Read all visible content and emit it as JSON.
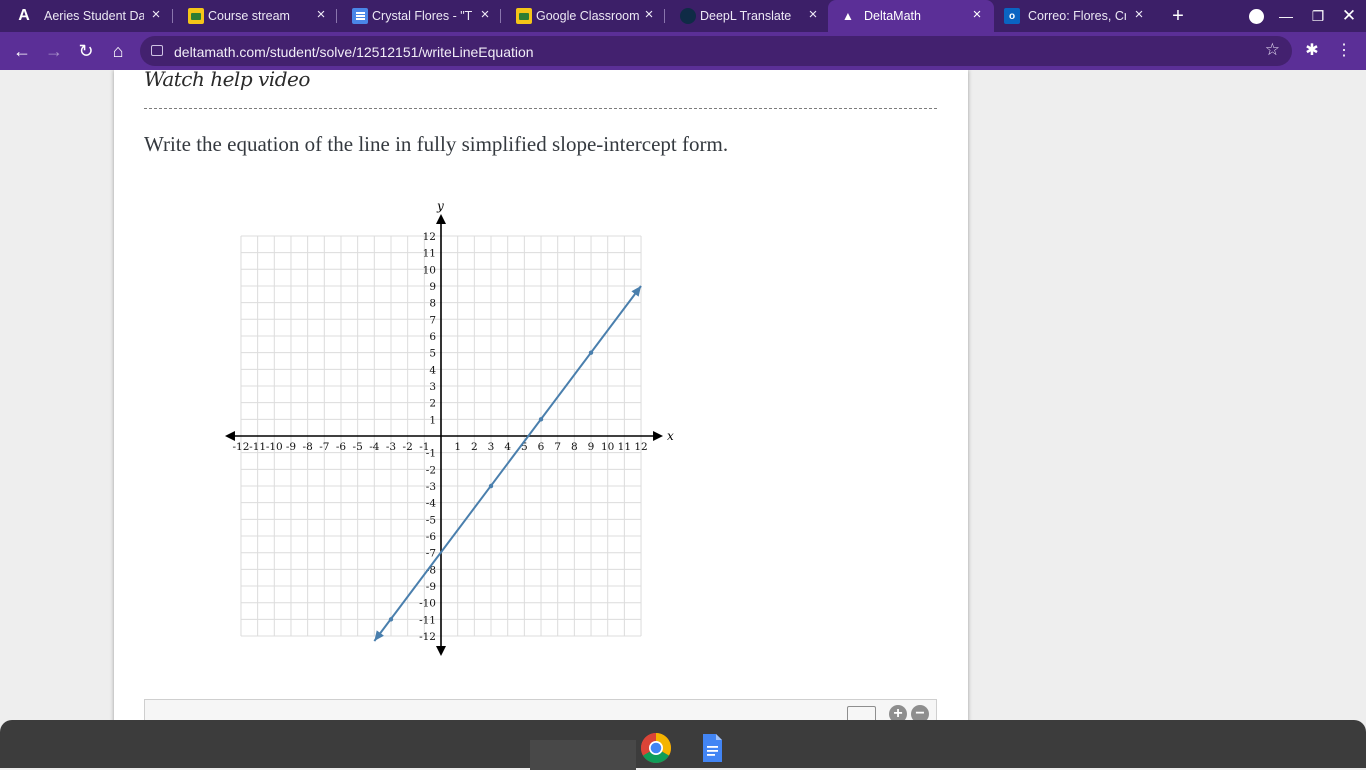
{
  "tabs": [
    {
      "title": "Aeries Student Da",
      "icon": "aeries-icon",
      "active": false
    },
    {
      "title": "Course stream",
      "icon": "classroom-icon",
      "active": false
    },
    {
      "title": "Crystal Flores - \"Th",
      "icon": "docs-icon",
      "active": false
    },
    {
      "title": "Google Classroom",
      "icon": "classroom-icon",
      "active": false
    },
    {
      "title": "DeepL Translate",
      "icon": "deepl-icon",
      "active": false
    },
    {
      "title": "DeltaMath",
      "icon": "deltamath-icon",
      "active": true
    },
    {
      "title": "Correo: Flores, Cry",
      "icon": "outlook-icon",
      "active": false
    }
  ],
  "address_bar": {
    "url": "deltamath.com/student/solve/12512151/writeLineEquation"
  },
  "page": {
    "help_link": "Watch help video",
    "instruction": "Write the equation of the line in fully simplified slope-intercept form."
  },
  "graph": {
    "x_axis_label": "x",
    "y_axis_label": "y",
    "x_range": [
      -12,
      12
    ],
    "y_range": [
      -12,
      12
    ],
    "grid": true,
    "x_ticks": [
      -12,
      -11,
      -10,
      -9,
      -8,
      -7,
      -6,
      -5,
      -4,
      -3,
      -2,
      -1,
      1,
      2,
      3,
      4,
      5,
      6,
      7,
      8,
      9,
      10,
      11,
      12
    ],
    "y_ticks": [
      12,
      11,
      10,
      9,
      8,
      7,
      6,
      5,
      4,
      3,
      2,
      1,
      -1,
      -2,
      -3,
      -4,
      -5,
      -6,
      -7,
      -8,
      -9,
      -10,
      -11,
      -12
    ],
    "line": {
      "points": [
        [
          -3,
          -11
        ],
        [
          3,
          -3
        ],
        [
          6,
          1
        ],
        [
          9,
          5
        ]
      ],
      "extends_to": [
        [
          -4,
          -12.3
        ],
        [
          12,
          9
        ]
      ],
      "color": "#4a7fad"
    }
  },
  "colors": {
    "tabbar": "#3c1f68",
    "toolbar": "#5b2f97",
    "page_background": "#eeeeee"
  }
}
